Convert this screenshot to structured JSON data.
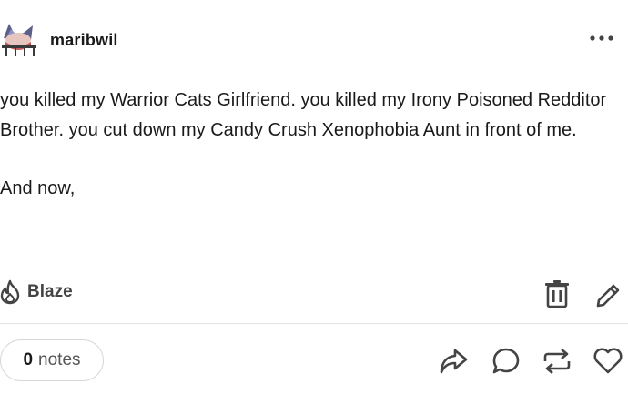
{
  "post": {
    "blog_name": "maribwil",
    "paragraphs": [
      "you killed my Warrior Cats Girlfriend. you killed my Irony Poisoned Redditor Brother. you cut down my Candy Crush Xenophobia Aunt in front of me.",
      "And now,"
    ]
  },
  "actions": {
    "blaze_label": "Blaze",
    "notes_count": "0",
    "notes_label": "notes"
  },
  "icons": {
    "more": "more-dots-icon",
    "blaze": "flame-icon",
    "trash": "trash-icon",
    "edit": "pencil-icon",
    "share": "share-arrow-icon",
    "reply": "speech-bubble-icon",
    "reblog": "reblog-icon",
    "like": "heart-icon"
  },
  "colors": {
    "text": "#1a1a1a",
    "icon": "#444444",
    "divider": "#e2e2e2",
    "pill_border": "#d8d8d8"
  }
}
